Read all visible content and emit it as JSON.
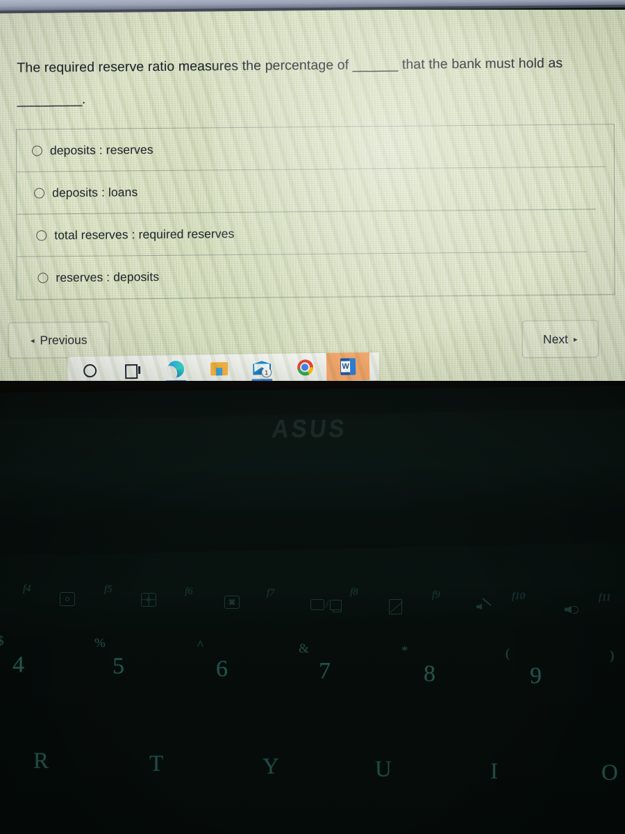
{
  "quiz": {
    "question_line1": "The required reserve ratio measures the percentage of ______ that the bank must hold as",
    "question_line2": "_________.",
    "options": [
      {
        "label": "deposits : reserves",
        "selected": false
      },
      {
        "label": "deposits : loans",
        "selected": false
      },
      {
        "label": "total reserves : required reserves",
        "selected": false
      },
      {
        "label": "reserves : deposits",
        "selected": false
      }
    ],
    "nav": {
      "previous_label": "Previous",
      "previous_arrow": "◂",
      "next_label": "Next",
      "next_arrow": "▸"
    }
  },
  "taskbar": {
    "items": [
      {
        "name": "cortana",
        "icon": "circle-icon",
        "active": false,
        "running": false,
        "badge": ""
      },
      {
        "name": "task-view",
        "icon": "task-view-icon",
        "active": false,
        "running": false,
        "badge": ""
      },
      {
        "name": "microsoft-edge",
        "icon": "edge-icon",
        "active": false,
        "running": true,
        "badge": ""
      },
      {
        "name": "file-explorer",
        "icon": "folder-icon",
        "active": false,
        "running": false,
        "badge": ""
      },
      {
        "name": "mail",
        "icon": "mail-icon",
        "active": false,
        "running": true,
        "badge": "1"
      },
      {
        "name": "google-chrome",
        "icon": "chrome-icon",
        "active": false,
        "running": false,
        "badge": ""
      },
      {
        "name": "microsoft-word",
        "icon": "word-icon",
        "active": true,
        "running": false,
        "badge": "",
        "letter": "W"
      }
    ]
  },
  "laptop": {
    "brand": "ASUS",
    "function_keys": [
      {
        "label": "f4",
        "icon": "keyboard-backlight-down-icon"
      },
      {
        "label": "f5",
        "icon": "keyboard-backlight-up-icon"
      },
      {
        "label": "f6",
        "icon": "touchpad-toggle-icon"
      },
      {
        "label": "f7",
        "icon": "display-toggle-icon"
      },
      {
        "label": "f8",
        "icon": "project-screen-icon"
      },
      {
        "label": "f9",
        "icon": "screen-lock-icon"
      },
      {
        "label": "f10",
        "icon": "mute-icon"
      },
      {
        "label": "f11",
        "icon": "volume-down-icon"
      }
    ],
    "number_row": [
      {
        "shift": "$",
        "key": "4"
      },
      {
        "shift": "%",
        "key": "5"
      },
      {
        "shift": "^",
        "key": "6"
      },
      {
        "shift": "&",
        "key": "7"
      },
      {
        "shift": "*",
        "key": "8"
      },
      {
        "shift": "(",
        "key": "9"
      },
      {
        "shift": ")",
        "key": ""
      }
    ],
    "letter_row": [
      {
        "key": "R"
      },
      {
        "key": "T"
      },
      {
        "key": "Y"
      },
      {
        "key": "U"
      },
      {
        "key": "I"
      },
      {
        "key": "O"
      }
    ]
  },
  "colors": {
    "screen_bg": "#dfe5c9",
    "text": "#1d242c",
    "divider": "#9aa89a",
    "taskbar_bg": "#eef0eb",
    "word_active": "#f2a56a",
    "edge_blue": "#0c7fc9",
    "keycap_text": "#2a5c53",
    "body_dark": "#08100e"
  }
}
